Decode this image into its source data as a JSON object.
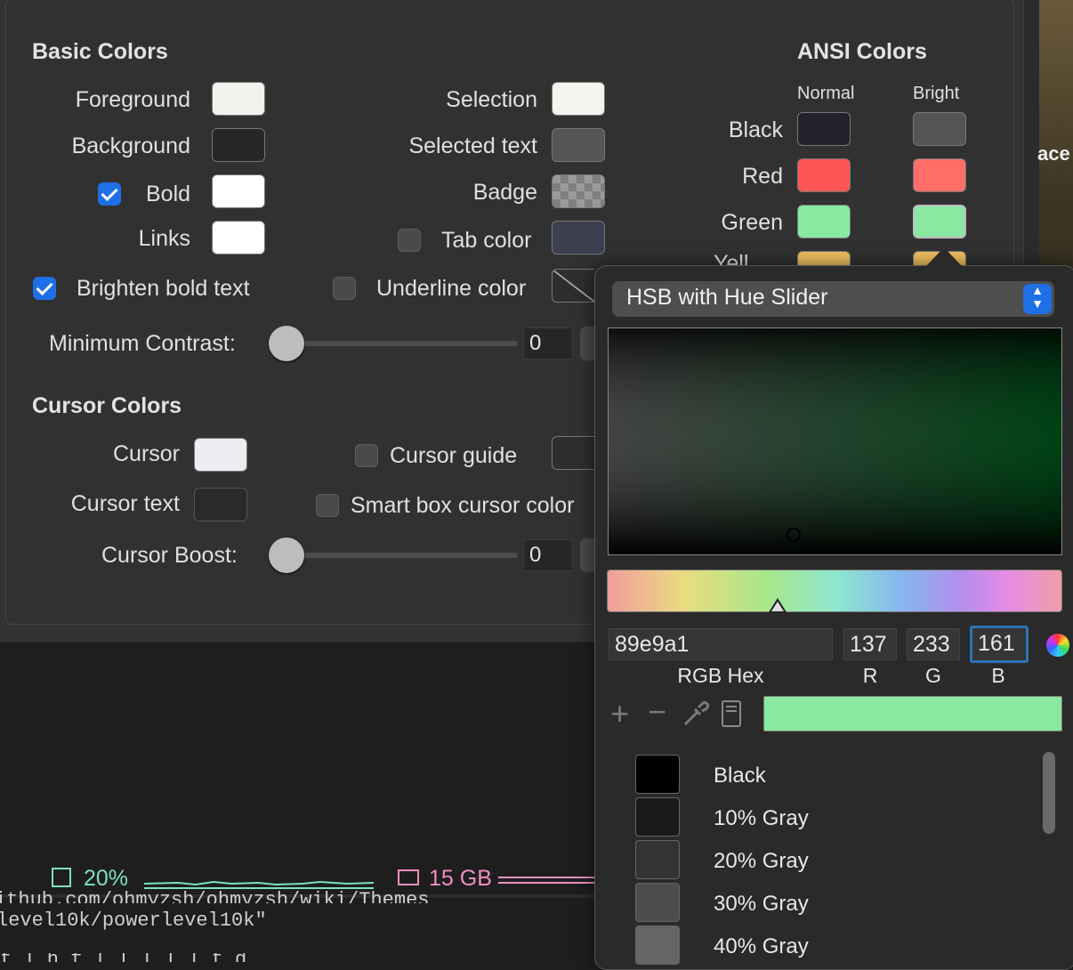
{
  "basic": {
    "heading": "Basic Colors",
    "foreground": "Foreground",
    "background": "Background",
    "bold": "Bold",
    "links": "Links",
    "selection": "Selection",
    "selected_text": "Selected text",
    "badge": "Badge",
    "tab_color": "Tab color",
    "brighten": "Brighten bold text",
    "underline": "Underline color",
    "min_contrast": "Minimum Contrast:",
    "min_contrast_value": "0",
    "colors": {
      "foreground": "#f3f3ee",
      "background": "#262626",
      "bold": "#ffffff",
      "links": "#ffffff",
      "selection": "#f4f4ef",
      "selected_text": "#555555",
      "tab_color": "#3b3f4f"
    }
  },
  "ansi": {
    "heading": "ANSI Colors",
    "normal": "Normal",
    "bright": "Bright",
    "black": "Black",
    "red": "Red",
    "green": "Green",
    "yellow_partial": "Yell",
    "colors": {
      "black_n": "#23232f",
      "black_b": "#555555",
      "red_n": "#ff5555",
      "red_b": "#ff6e67",
      "green_n": "#89e9a1",
      "green_b": "#89e9a1",
      "yellow_n": "#f3c060",
      "yellow_b": "#f3c060"
    }
  },
  "cursor": {
    "heading": "Cursor Colors",
    "cursor": "Cursor",
    "cursor_text": "Cursor text",
    "cursor_guide": "Cursor guide",
    "smart_box": "Smart box cursor color",
    "boost": "Cursor Boost:",
    "boost_value": "0",
    "colors": {
      "cursor": "#eceef4",
      "cursor_text": "#2a2a2a"
    }
  },
  "terminal": {
    "cpu": "20%",
    "mem": "15 GB",
    "line1": "ithub.com/ohmyzsh/ohmyzsh/wiki/Themes",
    "line2": "level10k/powerlevel10k\"",
    "line3": "  t  l   h f      l    l  l  l      l   t   d"
  },
  "wallpaper_text": "ace",
  "picker": {
    "mode": "HSB with Hue Slider",
    "hex": "89e9a1",
    "r": "137",
    "g": "233",
    "b": "161",
    "hex_label": "RGB Hex",
    "r_label": "R",
    "g_label": "G",
    "b_label": "B",
    "current_color": "#89e9a1",
    "palette": [
      {
        "name": "Black",
        "color": "#000000"
      },
      {
        "name": "10% Gray",
        "color": "#1a1a1a"
      },
      {
        "name": "20% Gray",
        "color": "#333333"
      },
      {
        "name": "30% Gray",
        "color": "#4d4d4d"
      },
      {
        "name": "40% Gray",
        "color": "#666666"
      }
    ]
  }
}
